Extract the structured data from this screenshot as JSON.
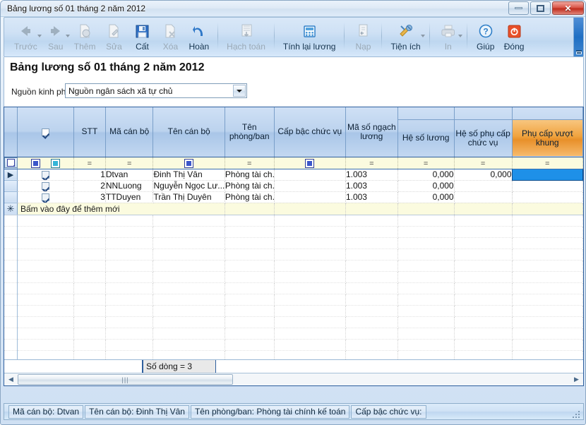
{
  "window": {
    "title": "Bảng lương số 01 tháng 2 năm 2012",
    "minimize_label": "",
    "maximize_label": "",
    "close_label": "✕"
  },
  "toolbar": {
    "items": [
      {
        "label": "Trước",
        "icon": "arrow-left-icon",
        "enabled": false,
        "has_caret": true
      },
      {
        "label": "Sau",
        "icon": "arrow-right-icon",
        "enabled": false,
        "has_caret": true
      },
      {
        "label": "Thêm",
        "icon": "add-page-icon",
        "enabled": false,
        "has_caret": false
      },
      {
        "label": "Sửa",
        "icon": "edit-page-icon",
        "enabled": false,
        "has_caret": false
      },
      {
        "label": "Cất",
        "icon": "save-icon",
        "enabled": true,
        "has_caret": false
      },
      {
        "label": "Xóa",
        "icon": "delete-page-icon",
        "enabled": false,
        "has_caret": false
      },
      {
        "label": "Hoàn",
        "icon": "undo-icon",
        "enabled": true,
        "has_caret": false
      },
      {
        "label": "Hạch toán",
        "icon": "ledger-icon",
        "enabled": false,
        "has_caret": false
      },
      {
        "label": "Tính lại lương",
        "icon": "calculator-icon",
        "enabled": true,
        "has_caret": false
      },
      {
        "label": "Nạp",
        "icon": "load-icon",
        "enabled": false,
        "has_caret": false
      },
      {
        "label": "Tiện ích",
        "icon": "tools-icon",
        "enabled": true,
        "has_caret": true
      },
      {
        "label": "In",
        "icon": "printer-icon",
        "enabled": false,
        "has_caret": true
      },
      {
        "label": "Giúp",
        "icon": "help-icon",
        "enabled": true,
        "has_caret": false
      },
      {
        "label": "Đóng",
        "icon": "close-power-icon",
        "enabled": true,
        "has_caret": false
      }
    ]
  },
  "page": {
    "title": "Bảng lương số 01 tháng 2 năm 2012",
    "filter_label": "Nguồn kinh phí",
    "filter_value": "Nguồn ngân sách xã tự chủ"
  },
  "grid": {
    "columns": [
      {
        "key": "check",
        "header": "",
        "type": "checkbox"
      },
      {
        "key": "stt",
        "header": "STT",
        "type": "number"
      },
      {
        "key": "ma_cb",
        "header": "Mã cán bộ",
        "type": "text"
      },
      {
        "key": "ten_cb",
        "header": "Tên cán bộ",
        "type": "text"
      },
      {
        "key": "phong_ban",
        "header": "Tên\nphòng/ban",
        "type": "text"
      },
      {
        "key": "cap_bac",
        "header": "Cấp bậc chức vụ",
        "type": "text"
      },
      {
        "key": "ma_ngach",
        "header": "Mã số ngạch\nlương",
        "type": "text"
      },
      {
        "key": "he_so_l",
        "header": "Hệ số lương",
        "type": "number"
      },
      {
        "key": "he_so_pc",
        "header": "Hệ số phụ cấp\nchức vụ",
        "type": "number"
      },
      {
        "key": "pc_vuot",
        "header": "Phụ cấp vượt khung",
        "type": "number",
        "selected": true
      }
    ],
    "filter_row": {
      "ops": [
        "=",
        "=",
        "",
        "=",
        "",
        "=",
        "=",
        "=",
        "="
      ]
    },
    "rows": [
      {
        "check": true,
        "stt": "1",
        "ma_cb": "Dtvan",
        "ten_cb": "Đinh Thị Vân",
        "phong_ban": "Phòng tài ch...",
        "cap_bac": "",
        "ma_ngach": "1.003",
        "he_so_l": "0,000",
        "he_so_pc": "0,000",
        "pc_vuot": ""
      },
      {
        "check": true,
        "stt": "2",
        "ma_cb": "NNLuong",
        "ten_cb": "Nguyễn Ngọc Lư...",
        "phong_ban": "Phòng tài ch...",
        "cap_bac": "",
        "ma_ngach": "1.003",
        "he_so_l": "0,000",
        "he_so_pc": "",
        "pc_vuot": ""
      },
      {
        "check": true,
        "stt": "3",
        "ma_cb": "TTDuyen",
        "ten_cb": "Trần Thị Duyên",
        "phong_ban": "Phòng tài ch...",
        "cap_bac": "",
        "ma_ngach": "1.003",
        "he_so_l": "0,000",
        "he_so_pc": "",
        "pc_vuot": ""
      }
    ],
    "new_row_text": "Bấm vào đây để thêm mới",
    "new_row_star": "✳",
    "summary": "Số dòng = 3"
  },
  "statusbar": {
    "cells": [
      "Mã cán bộ: Dtvan",
      "Tên cán bộ: Đinh Thị Vân",
      "Tên phòng/ban: Phòng tài chính kế toán",
      "Cấp bậc chức vụ:"
    ]
  }
}
